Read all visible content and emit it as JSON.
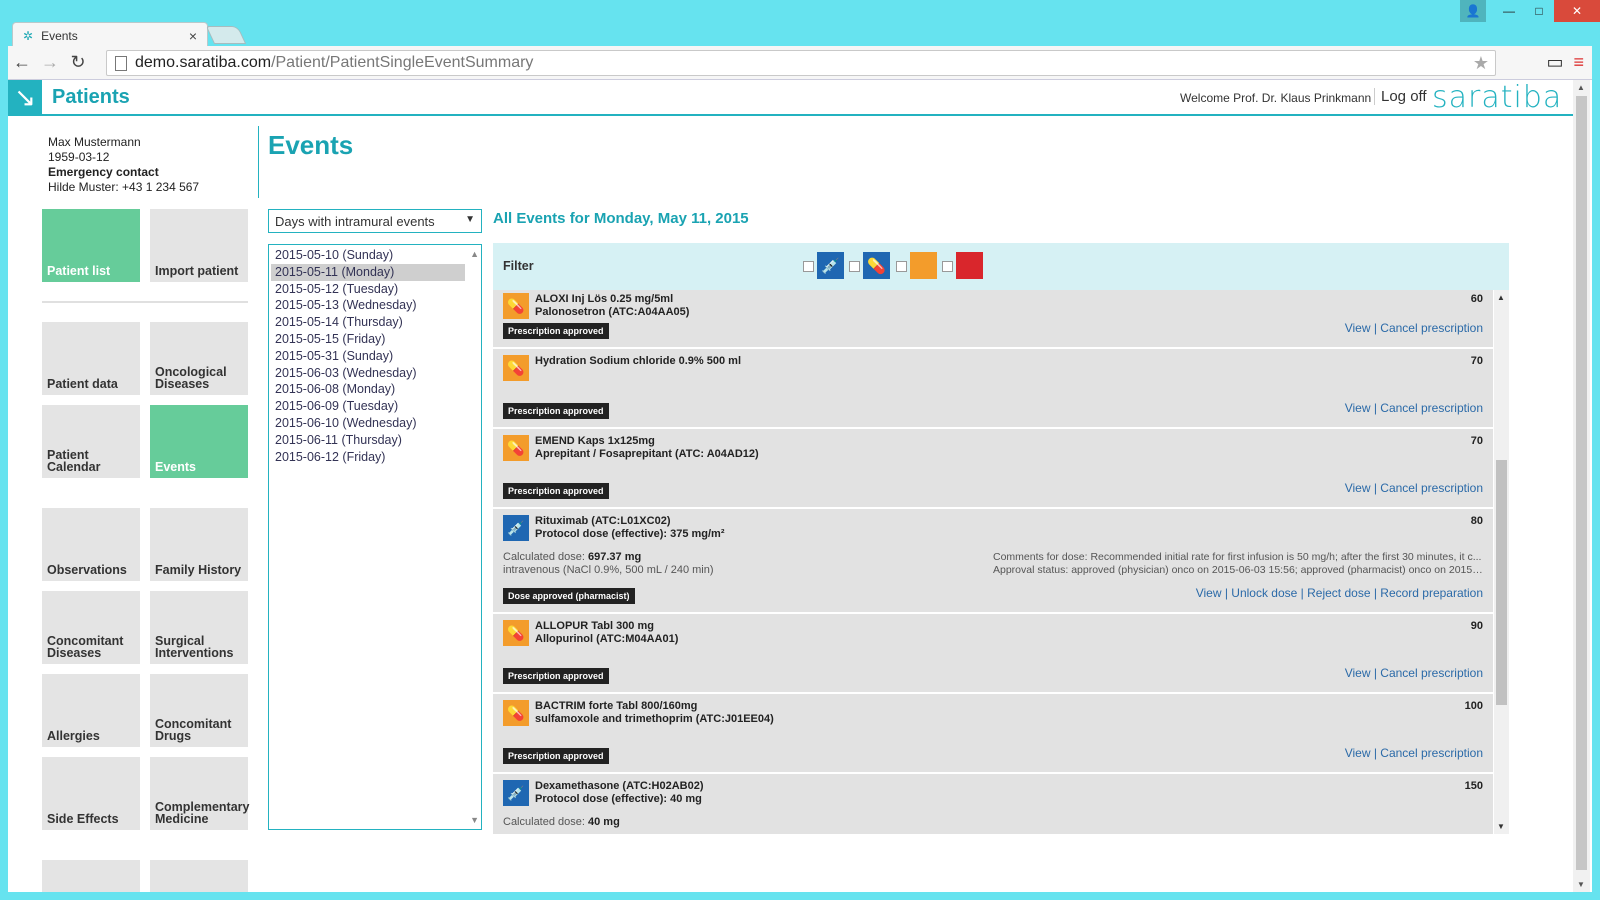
{
  "browser": {
    "tab_title": "Events",
    "url_host": "demo.saratiba.com",
    "url_path": "/Patient/PatientSingleEventSummary"
  },
  "header": {
    "title": "Patients",
    "welcome": "Welcome Prof. Dr. Klaus Prinkmann",
    "logoff": "Log off",
    "brand": "saratiba"
  },
  "patient": {
    "name": "Max Mustermann",
    "dob": "1959-03-12",
    "emergency_label": "Emergency contact",
    "emergency_contact": "Hilde Muster: +43 1 234 567"
  },
  "page_title": "Events",
  "sidebar": {
    "top": [
      {
        "label": "Patient list",
        "active": true
      },
      {
        "label": "Import patient",
        "active": false
      }
    ],
    "items": [
      {
        "label": "Patient data"
      },
      {
        "label": "Oncological Diseases"
      },
      {
        "label": "Patient Calendar"
      },
      {
        "label": "Events"
      },
      {
        "label": "Observations"
      },
      {
        "label": "Family History"
      },
      {
        "label": "Concomitant Diseases"
      },
      {
        "label": "Surgical Interventions"
      },
      {
        "label": "Allergies"
      },
      {
        "label": "Concomitant Drugs"
      },
      {
        "label": "Side Effects"
      },
      {
        "label": "Complementary Medicine"
      }
    ]
  },
  "days_filter": {
    "selected": "Days with intramural events"
  },
  "days": [
    "2015-05-10 (Sunday)",
    "2015-05-11 (Monday)",
    "2015-05-12 (Tuesday)",
    "2015-05-13 (Wednesday)",
    "2015-05-14 (Thursday)",
    "2015-05-15 (Friday)",
    "2015-05-31 (Sunday)",
    "2015-06-03 (Wednesday)",
    "2015-06-08 (Monday)",
    "2015-06-09 (Tuesday)",
    "2015-06-10 (Wednesday)",
    "2015-06-11 (Thursday)",
    "2015-06-12 (Friday)"
  ],
  "events_title": "All Events for Monday, May 11, 2015",
  "filter": {
    "label": "Filter",
    "icons": [
      "syringe-icon",
      "pill-icon",
      "orange-square",
      "red-square"
    ],
    "colors": {
      "blue": "#1f67b2",
      "orange": "#f39c2b",
      "red": "#d9262c"
    }
  },
  "events": [
    {
      "icon": "pill-icon",
      "name1": "ALOXI Inj Lös 0.25 mg/5ml",
      "name2": "Palonosetron (ATC:A04AA05)",
      "num": "60",
      "badge": "Prescription approved",
      "links": "View | Cancel prescription"
    },
    {
      "icon": "pill-icon",
      "name1": "Hydration Sodium chloride 0.9% 500 ml",
      "name2": "",
      "num": "70",
      "badge": "Prescription approved",
      "links": "View | Cancel prescription"
    },
    {
      "icon": "pill-icon",
      "name1": "EMEND Kaps 1x125mg",
      "name2": "Aprepitant / Fosaprepitant (ATC: A04AD12)",
      "num": "70",
      "badge": "Prescription approved",
      "links": "View | Cancel prescription"
    },
    {
      "icon": "syringe-icon",
      "name1": "Rituximab (ATC:L01XC02)",
      "name2": "Protocol dose (effective): 375 mg/m²",
      "num": "80",
      "dose_label": "Calculated dose: ",
      "dose_value": "697.37 mg",
      "route": "intravenous (NaCl 0.9%, 500 mL / 240 min)",
      "comment": "Comments for dose: Recommended initial rate for first infusion is 50 mg/h; after the first 30 minutes, it c...",
      "approval": "Approval status: approved (physician) onco on 2015-06-03 15:56; approved (pharmacist) onco on 2015-0...",
      "badge": "Dose approved (pharmacist)",
      "links": "View | Unlock dose | Reject dose | Record preparation"
    },
    {
      "icon": "pill-icon",
      "name1": "ALLOPUR Tabl 300 mg",
      "name2": "Allopurinol (ATC:M04AA01)",
      "num": "90",
      "badge": "Prescription approved",
      "links": "View | Cancel prescription"
    },
    {
      "icon": "pill-icon",
      "name1": "BACTRIM forte Tabl 800/160mg",
      "name2": "sulfamoxole and trimethoprim (ATC:J01EE04)",
      "num": "100",
      "badge": "Prescription approved",
      "links": "View | Cancel prescription"
    },
    {
      "icon": "syringe-icon",
      "name1": "Dexamethasone (ATC:H02AB02)",
      "name2": "Protocol dose (effective): 40 mg",
      "num": "150",
      "dose_label": "Calculated dose: ",
      "dose_value": "40 mg"
    }
  ]
}
